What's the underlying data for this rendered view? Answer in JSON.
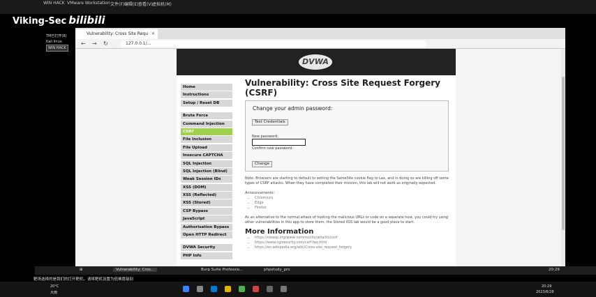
{
  "vm": {
    "title_items": [
      "WIN HACK",
      "VMware Workstation",
      "文件(F)",
      "编辑(E)",
      "查看(V)",
      "虚拟机(M)",
      "选项卡(T)",
      "帮助(H)"
    ]
  },
  "watermark": {
    "text": "Viking-Sec",
    "brand": "bilibili"
  },
  "tooltip": {
    "line1": "TM已打开(B)",
    "line2": "Kali linux",
    "line3": "WIN HACK"
  },
  "browser": {
    "tab_title": "Vulnerability: Cross Site Requ",
    "url": "127.0.0.1/..."
  },
  "dvwa": {
    "logo": "DVWA",
    "menu": [
      "Home",
      "Instructions",
      "Setup / Reset DB",
      "",
      "Brute Force",
      "Command Injection",
      "CSRF",
      "File Inclusion",
      "File Upload",
      "Insecure CAPTCHA",
      "SQL Injection",
      "SQL Injection (Blind)",
      "Weak Session IDs",
      "XSS (DOM)",
      "XSS (Reflected)",
      "XSS (Stored)",
      "CSP Bypass",
      "JavaScript",
      "Authorisation Bypass",
      "Open HTTP Redirect",
      "",
      "DVWA Security",
      "PHP Info"
    ],
    "active_menu": "CSRF",
    "heading": "Vulnerability: Cross Site Request Forgery (CSRF)",
    "card_heading": "Change your admin password:",
    "test_button": "Test Credentials",
    "new_password_label": "New password:",
    "confirm_label": "Confirm new password:",
    "change_button": "Change",
    "note": "Note: Browsers are starting to default to setting the SameSite cookie flag to Lax, and in doing so are killing off some types of CSRF attacks. When they have completed their mission, this lab will not work as originally expected.",
    "announcements_label": "Announcements:",
    "announcements": [
      "Chromium",
      "Edge",
      "Firefox"
    ],
    "alternative": "As an alternative to the normal attack of hosting the malicious URLs or code on a separate host, you could try using other vulnerabilities in this app to store them, the Stored XSS lab would be a good place to start.",
    "more_info": "More Information",
    "links": [
      "https://owasp.org/www-community/attacks/csrf",
      "https://www.cgisecurity.com/csrf-faq.html",
      "https://en.wikipedia.org/wiki/Cross-site_request_forgery"
    ]
  },
  "taskbar_inner": {
    "active_app": "Vulnerability: Cros...",
    "apps": [
      "Burp Suite Professio...",
      "phpstudy_pro"
    ],
    "time": "20:29"
  },
  "subtitle": "靶场选择的是我们的打开靶机，请将靶机设置为低难度级别",
  "taskbar_outer": {
    "weather": "20°C",
    "weather_desc": "大雨",
    "time": "20:29",
    "date": "2023/6/28"
  }
}
